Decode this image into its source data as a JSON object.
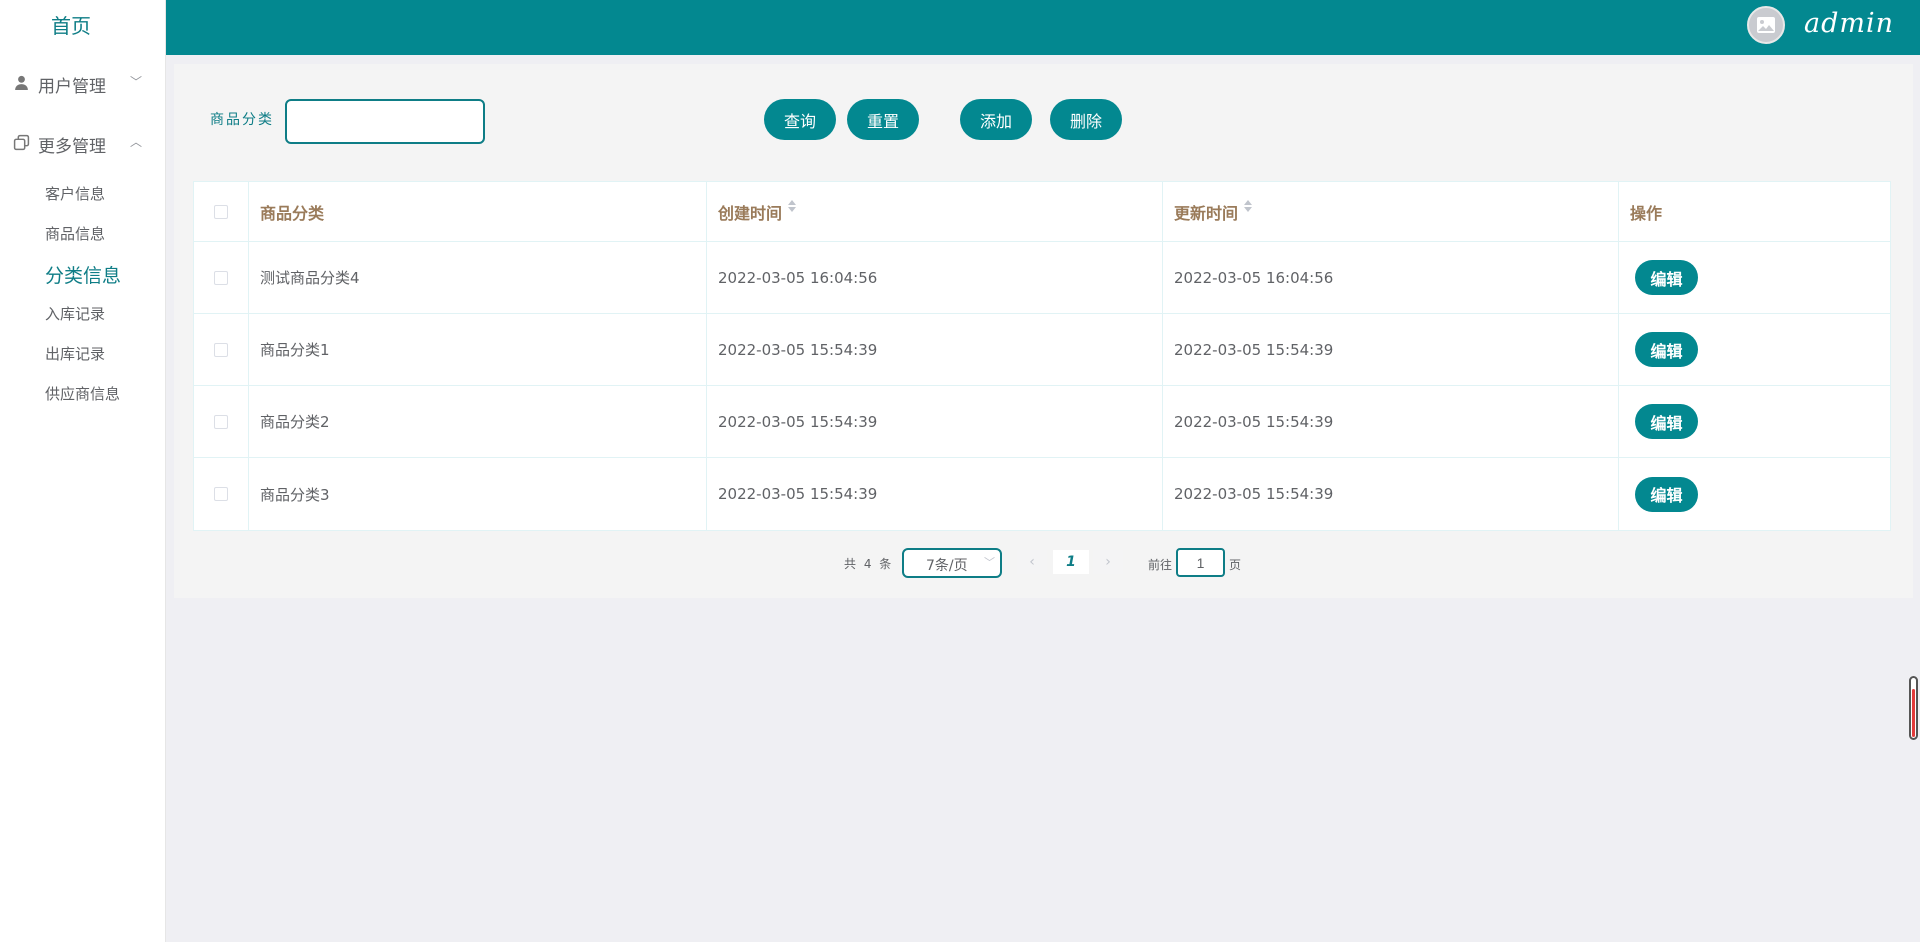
{
  "sidebar": {
    "home": "首页",
    "groups": [
      {
        "label": "用户管理",
        "icon": "user-icon",
        "expanded": false
      },
      {
        "label": "更多管理",
        "icon": "copy-icon",
        "expanded": true
      }
    ],
    "items": [
      {
        "label": "客户信息"
      },
      {
        "label": "商品信息"
      },
      {
        "label": "分类信息",
        "active": true
      },
      {
        "label": "入库记录"
      },
      {
        "label": "出库记录"
      },
      {
        "label": "供应商信息"
      }
    ]
  },
  "header": {
    "username": "admin",
    "avatar_icon": "image-placeholder-icon",
    "bg_color": "#038890"
  },
  "search": {
    "label": "商品分类",
    "value": "",
    "placeholder": ""
  },
  "actions": {
    "query": "查询",
    "reset": "重置",
    "add": "添加",
    "delete": "删除"
  },
  "table": {
    "columns": [
      "商品分类",
      "创建时间",
      "更新时间",
      "操作"
    ],
    "rows": [
      {
        "name": "测试商品分类4",
        "created": "2022-03-05 16:04:56",
        "updated": "2022-03-05 16:04:56",
        "action": "编辑"
      },
      {
        "name": "商品分类1",
        "created": "2022-03-05 15:54:39",
        "updated": "2022-03-05 15:54:39",
        "action": "编辑"
      },
      {
        "name": "商品分类2",
        "created": "2022-03-05 15:54:39",
        "updated": "2022-03-05 15:54:39",
        "action": "编辑"
      },
      {
        "name": "商品分类3",
        "created": "2022-03-05 15:54:39",
        "updated": "2022-03-05 15:54:39",
        "action": "编辑"
      }
    ]
  },
  "pager": {
    "total": "共 4 条",
    "page_size": "7条/页",
    "current_page": "1",
    "goto_prefix": "前往",
    "goto_value": "1",
    "goto_suffix": "页"
  },
  "colors": {
    "accent": "#038890",
    "accent_text": "#0e7d86",
    "header_text": "#9a7b5a"
  }
}
